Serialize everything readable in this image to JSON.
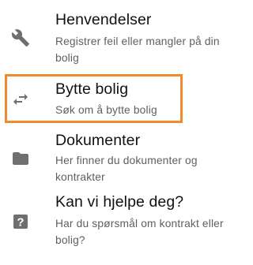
{
  "menu": {
    "items": [
      {
        "icon": "wrench-icon",
        "title": "Henvendelser",
        "description": "Registrer feil eller mangler på din bolig"
      },
      {
        "icon": "swap-arrows-icon",
        "title": "Bytte bolig",
        "description": "Søk om å bytte bolig",
        "highlighted": true
      },
      {
        "icon": "folder-icon",
        "title": "Dokumenter",
        "description": "Her finner du dokumenter og kontrakter"
      },
      {
        "icon": "question-box-icon",
        "title": "Kan vi hjelpe deg?",
        "description": "Har du spørsmål om kontrakt eller bolig?"
      }
    ]
  },
  "colors": {
    "highlight_border": "#f08a2c",
    "icon": "#6f6f6f",
    "title": "#111111",
    "description": "#5f5f5f"
  }
}
